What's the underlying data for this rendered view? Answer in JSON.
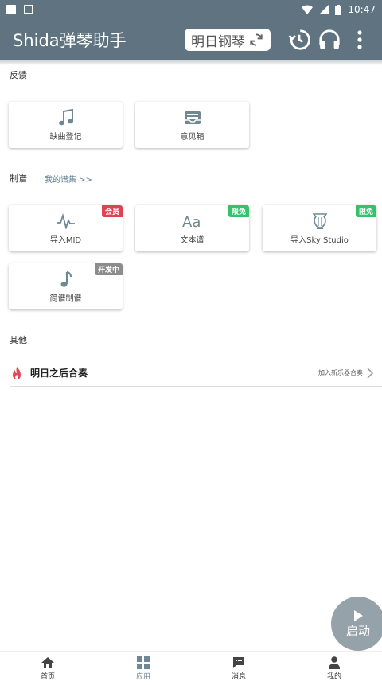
{
  "status_bar": {
    "time": "10:47"
  },
  "app_bar": {
    "title": "Shida弹琴助手",
    "piano_chip": "明日钢琴",
    "icons": [
      "history-icon",
      "headphones-icon",
      "more-vert-icon"
    ]
  },
  "feedback": {
    "label": "反馈",
    "cards": [
      {
        "label": "缺曲登记",
        "icon": "music-note-icon"
      },
      {
        "label": "意见箱",
        "icon": "inbox-icon"
      }
    ]
  },
  "scoring": {
    "label": "制谱",
    "link": "我的谱集 >>",
    "cards": [
      {
        "label": "导入MID",
        "icon": "waveform-icon",
        "badge": "会员",
        "badge_color": "#e0434f"
      },
      {
        "label": "文本谱",
        "icon": "text-aa-icon",
        "badge": "限免",
        "badge_color": "#34c26a"
      },
      {
        "label": "导入Sky Studio",
        "icon": "lyre-icon",
        "badge": "限免",
        "badge_color": "#34c26a"
      },
      {
        "label": "简谱制谱",
        "icon": "eighth-note-icon",
        "badge": "开发中",
        "badge_color": "#8c8c8c"
      }
    ]
  },
  "other": {
    "label": "其他",
    "row": {
      "title": "明日之后合奏",
      "note": "加入新乐器合奏",
      "icon": "flame-icon",
      "icon_color": "#e24a5a"
    }
  },
  "fab": {
    "label": "启动"
  },
  "bottom_nav": [
    {
      "label": "首页",
      "icon": "home-icon"
    },
    {
      "label": "应用",
      "icon": "grid-icon",
      "active": true
    },
    {
      "label": "消息",
      "icon": "chat-icon"
    },
    {
      "label": "我的",
      "icon": "person-icon"
    }
  ],
  "colors": {
    "primary": "#5f7480",
    "accent_icon": "#6f8894"
  }
}
